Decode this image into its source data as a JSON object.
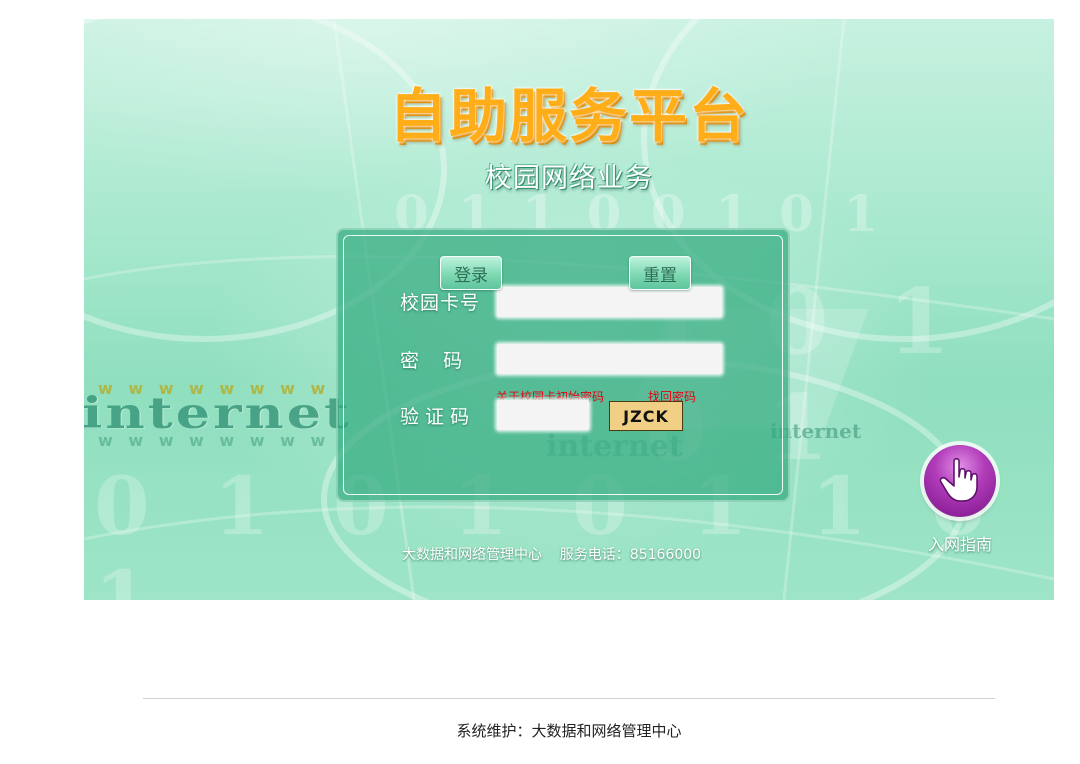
{
  "banner": {
    "title": "自助服务平台",
    "subtitle": "校园网络业务",
    "watermarks": {
      "internet": "internet",
      "www": "w w w w w w w w",
      "binary_top": "0 1 1 0 0 1 0 1",
      "binary_mid": "1 0 1 0 1",
      "binary_bottom": "0 1 0 1 0 1 1 0 1"
    }
  },
  "login": {
    "card_label": "校园卡号",
    "password_label": "密    码",
    "captcha_label": "验 证 码",
    "card_value": "",
    "password_value": "",
    "captcha_value": "",
    "initial_password_link": "关于校园卡初始密码",
    "recover_password_link": "找回密码",
    "captcha_code": "JZCK",
    "login_button": "登录",
    "reset_button": "重置"
  },
  "contact": {
    "info": "大数据和网络管理中心    服务电话：85166000"
  },
  "guide": {
    "label": "入网指南",
    "icon": "pointing-hand-icon"
  },
  "footer": {
    "maintenance": "系统维护：大数据和网络管理中心"
  },
  "colors": {
    "title": "#ffae1a",
    "panel": "#30aa7e",
    "link": "#e60012",
    "captcha_bg": "#f1cf84",
    "guide": "#b13cb9"
  }
}
